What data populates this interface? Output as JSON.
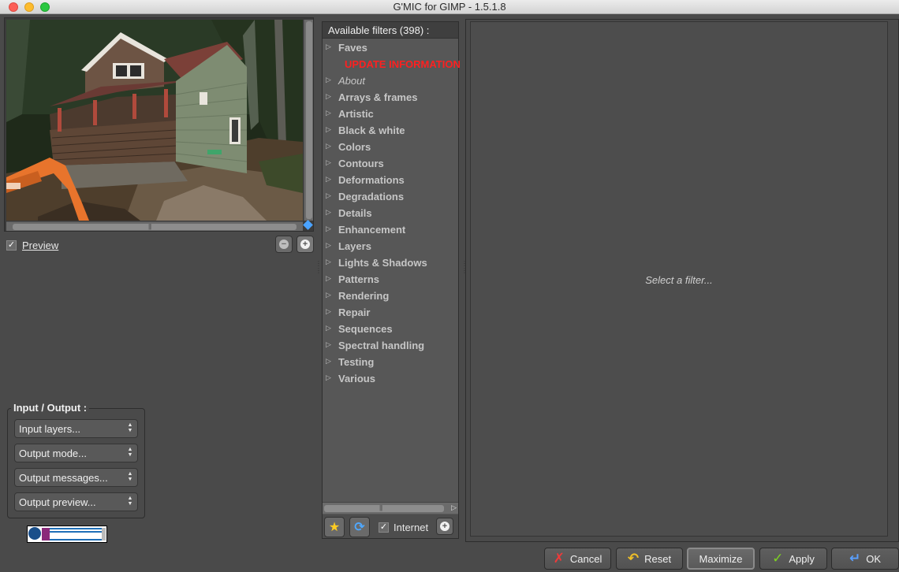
{
  "window": {
    "title": "G'MIC for GIMP - 1.5.1.8"
  },
  "preview": {
    "label": "Preview",
    "checked": true
  },
  "io": {
    "title": "Input / Output :",
    "input_layers": "Input layers...",
    "output_mode": "Output mode...",
    "output_messages": "Output messages...",
    "output_preview": "Output preview..."
  },
  "logos": {
    "left": "CNRS",
    "right": "ENSICAEN"
  },
  "filters": {
    "header": "Available filters (398) :",
    "items": [
      {
        "label": "Faves"
      },
      {
        "label": "UPDATE INFORMATION"
      },
      {
        "label": "About"
      },
      {
        "label": "Arrays & frames"
      },
      {
        "label": "Artistic"
      },
      {
        "label": "Black & white"
      },
      {
        "label": "Colors"
      },
      {
        "label": "Contours"
      },
      {
        "label": "Deformations"
      },
      {
        "label": "Degradations"
      },
      {
        "label": "Details"
      },
      {
        "label": "Enhancement"
      },
      {
        "label": "Layers"
      },
      {
        "label": "Lights & Shadows"
      },
      {
        "label": "Patterns"
      },
      {
        "label": "Rendering"
      },
      {
        "label": "Repair"
      },
      {
        "label": "Sequences"
      },
      {
        "label": "Spectral handling"
      },
      {
        "label": "Testing"
      },
      {
        "label": "Various"
      }
    ],
    "internet_label": "Internet",
    "internet_checked": true
  },
  "params": {
    "hint": "Select a filter..."
  },
  "buttons": {
    "cancel": "Cancel",
    "reset": "Reset",
    "maximize": "Maximize",
    "apply": "Apply",
    "ok": "OK"
  },
  "icons": {
    "cancel": "x-icon",
    "reset": "undo-icon",
    "apply": "check-icon",
    "ok": "enter-arrow-icon",
    "star": "star-icon",
    "refresh": "refresh-icon",
    "zoom_out": "minus-circle-icon",
    "zoom_in": "plus-circle-icon"
  },
  "colors": {
    "update_information": "#ff2020",
    "cancel_icon": "#ee3a3a",
    "apply_icon": "#7ed321",
    "ok_icon": "#5aa0ff",
    "star_icon": "#ffcc22",
    "selection_handle": "#4aa3ff"
  }
}
